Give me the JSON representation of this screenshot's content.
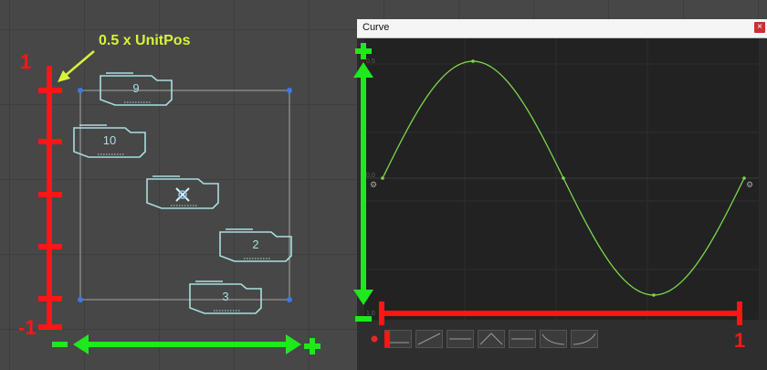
{
  "scene": {
    "callout_text": "0.5 x UnitPos",
    "left_axis_top_label": "1",
    "left_axis_bottom_label": "-1",
    "bottom_axis_minus": "-",
    "bottom_axis_plus": "+",
    "tiles": [
      {
        "label": "9",
        "icon": ""
      },
      {
        "label": "10",
        "icon": ""
      },
      {
        "label": "",
        "icon": "crosshair-icon"
      },
      {
        "label": "2",
        "icon": ""
      },
      {
        "label": "3",
        "icon": ""
      }
    ],
    "colors": {
      "red_marker": "#ff1515",
      "green_marker": "#1fe81f",
      "callout": "#d8f23a",
      "tile_outline": "#a9dede"
    }
  },
  "curve_window": {
    "title": "Curve",
    "close_glyph": "×",
    "y_ticks": [
      "0.5",
      "0.0",
      "1.0"
    ],
    "curve_color": "#7cd84a",
    "side_plus": "+",
    "side_minus": "-",
    "range_end_label": "1",
    "presets": [
      "flat",
      "linear",
      "flat-line",
      "hill",
      "flat-mid",
      "ease-out",
      "ease-in"
    ]
  },
  "chart_data": {
    "type": "line",
    "title": "",
    "xlabel": "",
    "ylabel": "",
    "x": [
      0,
      0.25,
      0.5,
      0.75,
      1.0
    ],
    "values": [
      0,
      1,
      0,
      -1,
      0
    ],
    "xlim": [
      0,
      1
    ],
    "ylim": [
      -1,
      1
    ]
  }
}
